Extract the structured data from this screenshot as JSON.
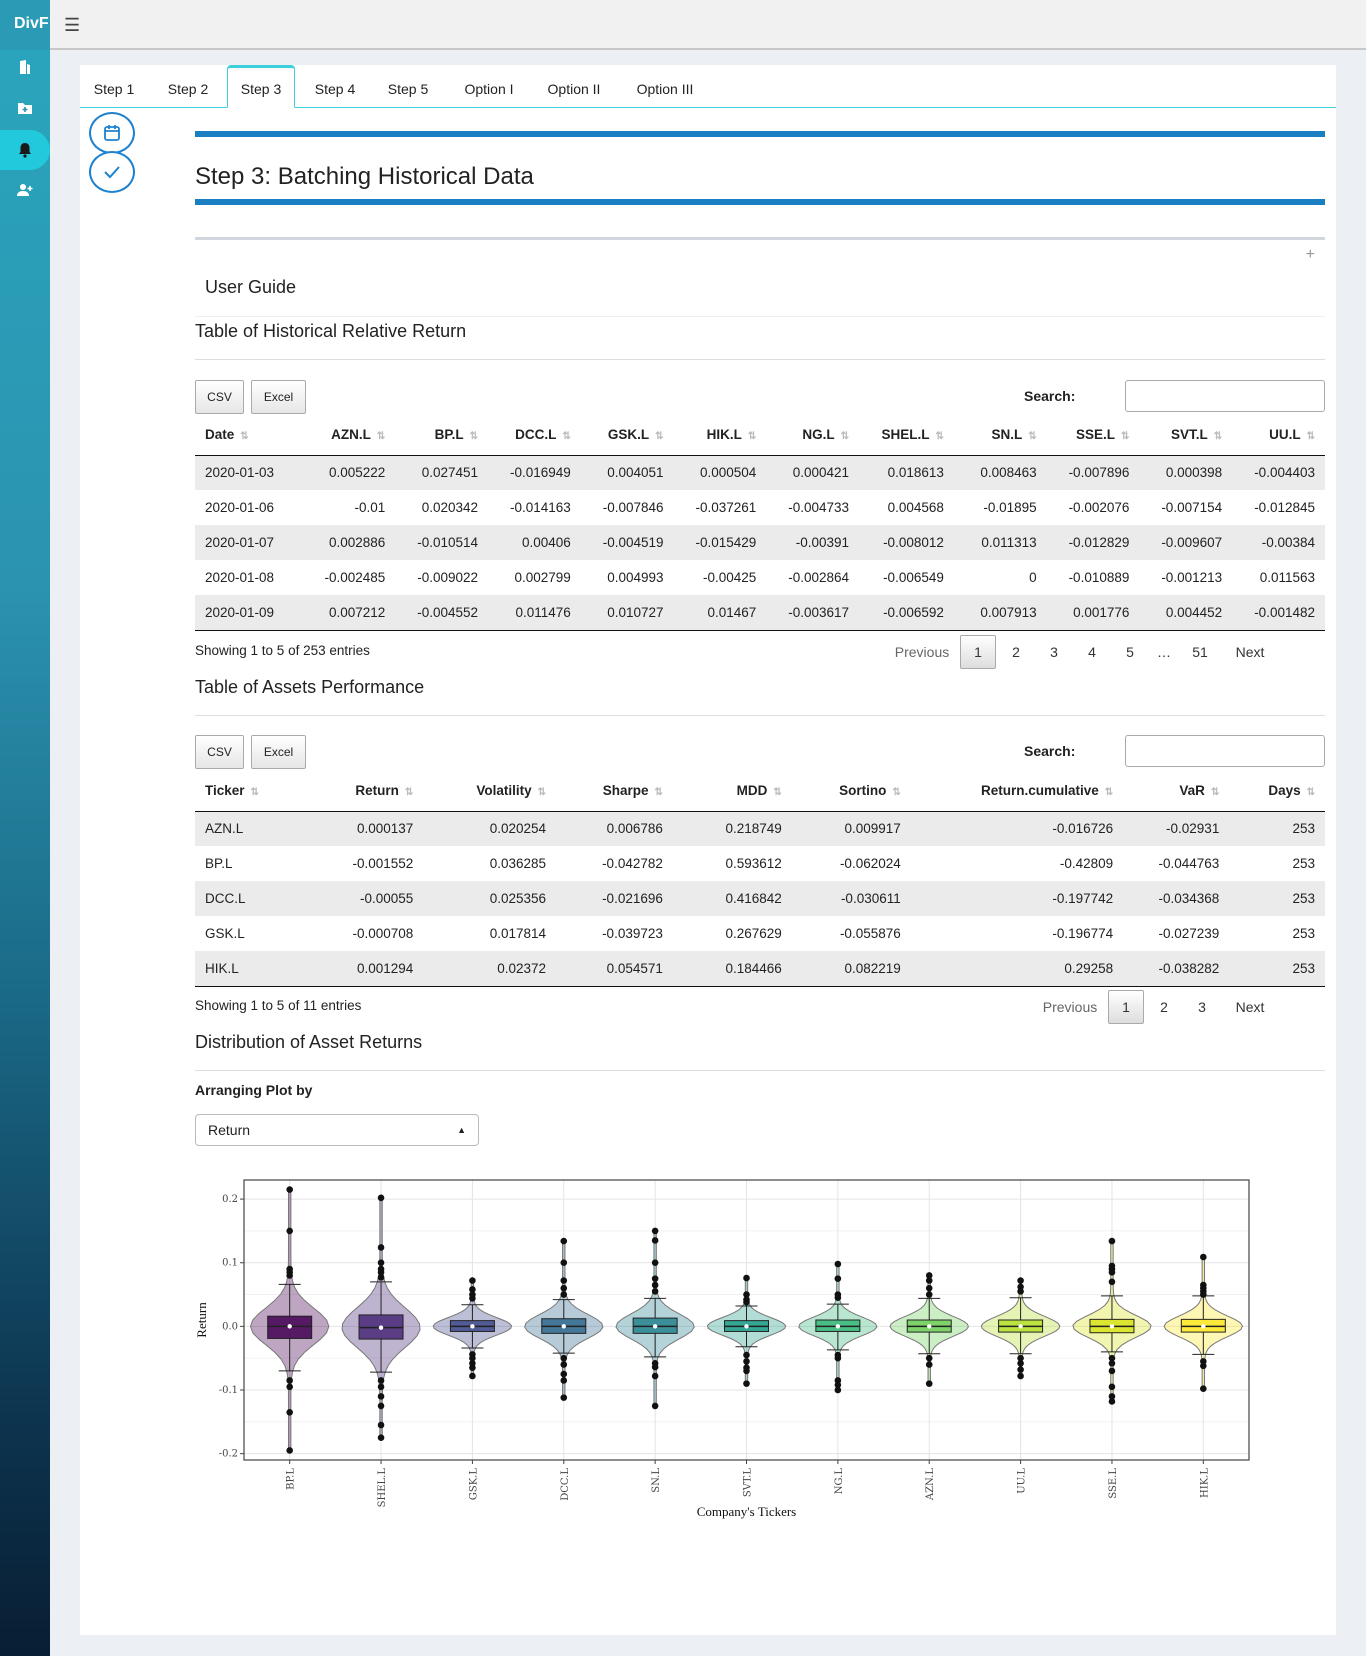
{
  "app": {
    "brand": "DivF",
    "menu_icon": "hamburger-icon"
  },
  "sidebar": {
    "icons": [
      "building-icon",
      "folder-plus-icon",
      "bell-icon",
      "user-plus-icon"
    ],
    "active_index": 2
  },
  "tabs": [
    "Step 1",
    "Step 2",
    "Step 3",
    "Step 4",
    "Step 5",
    "Option I",
    "Option II",
    "Option III"
  ],
  "active_tab": "Step 3",
  "side_buttons": [
    "calendar-icon",
    "check-icon"
  ],
  "page": {
    "title": "Step 3: Batching Historical Data"
  },
  "guide": {
    "title": "User Guide",
    "toggle": "+"
  },
  "returns_section": {
    "title": "Table of Historical Relative Return",
    "buttons": {
      "csv": "CSV",
      "excel": "Excel"
    },
    "search_label": "Search:",
    "search_value": "",
    "columns": [
      "Date",
      "AZN.L",
      "BP.L",
      "DCC.L",
      "GSK.L",
      "HIK.L",
      "NG.L",
      "SHEL.L",
      "SN.L",
      "SSE.L",
      "SVT.L",
      "UU.L"
    ],
    "rows": [
      [
        "2020-01-03",
        "0.005222",
        "0.027451",
        "-0.016949",
        "0.004051",
        "0.000504",
        "0.000421",
        "0.018613",
        "0.008463",
        "-0.007896",
        "0.000398",
        "-0.004403"
      ],
      [
        "2020-01-06",
        "-0.01",
        "0.020342",
        "-0.014163",
        "-0.007846",
        "-0.037261",
        "-0.004733",
        "0.004568",
        "-0.01895",
        "-0.002076",
        "-0.007154",
        "-0.012845"
      ],
      [
        "2020-01-07",
        "0.002886",
        "-0.010514",
        "0.00406",
        "-0.004519",
        "-0.015429",
        "-0.00391",
        "-0.008012",
        "0.011313",
        "-0.012829",
        "-0.009607",
        "-0.00384"
      ],
      [
        "2020-01-08",
        "-0.002485",
        "-0.009022",
        "0.002799",
        "0.004993",
        "-0.00425",
        "-0.002864",
        "-0.006549",
        "0",
        "-0.010889",
        "-0.001213",
        "0.011563"
      ],
      [
        "2020-01-09",
        "0.007212",
        "-0.004552",
        "0.011476",
        "0.010727",
        "0.01467",
        "-0.003617",
        "-0.006592",
        "0.007913",
        "0.001776",
        "0.004452",
        "-0.001482"
      ]
    ],
    "info": "Showing 1 to 5 of 253 entries",
    "pager": {
      "previous": "Previous",
      "pages": [
        "1",
        "2",
        "3",
        "4",
        "5",
        "…",
        "51"
      ],
      "current": "1",
      "next": "Next"
    }
  },
  "perf_section": {
    "title": "Table of Assets Performance",
    "buttons": {
      "csv": "CSV",
      "excel": "Excel"
    },
    "search_label": "Search:",
    "search_value": "",
    "columns": [
      "Ticker",
      "Return",
      "Volatility",
      "Sharpe",
      "MDD",
      "Sortino",
      "Return.cumulative",
      "VaR",
      "Days"
    ],
    "rows": [
      [
        "AZN.L",
        "0.000137",
        "0.020254",
        "0.006786",
        "0.218749",
        "0.009917",
        "-0.016726",
        "-0.02931",
        "253"
      ],
      [
        "BP.L",
        "-0.001552",
        "0.036285",
        "-0.042782",
        "0.593612",
        "-0.062024",
        "-0.42809",
        "-0.044763",
        "253"
      ],
      [
        "DCC.L",
        "-0.00055",
        "0.025356",
        "-0.021696",
        "0.416842",
        "-0.030611",
        "-0.197742",
        "-0.034368",
        "253"
      ],
      [
        "GSK.L",
        "-0.000708",
        "0.017814",
        "-0.039723",
        "0.267629",
        "-0.055876",
        "-0.196774",
        "-0.027239",
        "253"
      ],
      [
        "HIK.L",
        "0.001294",
        "0.02372",
        "0.054571",
        "0.184466",
        "0.082219",
        "0.29258",
        "-0.038282",
        "253"
      ]
    ],
    "info": "Showing 1 to 5 of 11 entries",
    "pager": {
      "previous": "Previous",
      "pages": [
        "1",
        "2",
        "3"
      ],
      "current": "1",
      "next": "Next"
    }
  },
  "dist_section": {
    "title": "Distribution of Asset Returns",
    "control_label": "Arranging Plot by",
    "selected": "Return"
  },
  "chart_data": {
    "type": "violin-box",
    "xlabel": "Company's Tickers",
    "ylabel": "Return",
    "ylim": [
      -0.21,
      0.23
    ],
    "yticks": [
      0.2,
      0.1,
      0.0,
      -0.1,
      -0.2
    ],
    "ytick_labels": [
      "0.2",
      "0.1",
      "0.0",
      "-0.1",
      "-0.2"
    ],
    "grid": true,
    "series": [
      {
        "ticker": "BP.L",
        "color": "#440154",
        "median": 0.0,
        "q1": -0.019,
        "q3": 0.016,
        "whisker_low": -0.07,
        "whisker_high": 0.066,
        "outliers": [
          0.215,
          0.15,
          0.09,
          0.085,
          0.08,
          -0.085,
          -0.095,
          -0.135,
          -0.195
        ]
      },
      {
        "ticker": "SHEL.L",
        "color": "#482878",
        "median": -0.002,
        "q1": -0.02,
        "q3": 0.018,
        "whisker_low": -0.072,
        "whisker_high": 0.07,
        "outliers": [
          0.202,
          0.124,
          0.1,
          0.09,
          0.085,
          0.077,
          -0.085,
          -0.095,
          -0.11,
          -0.125,
          -0.155,
          -0.175
        ]
      },
      {
        "ticker": "GSK.L",
        "color": "#3e4989",
        "median": 0.0,
        "q1": -0.008,
        "q3": 0.009,
        "whisker_low": -0.034,
        "whisker_high": 0.034,
        "outliers": [
          0.072,
          0.058,
          0.05,
          0.044,
          -0.044,
          -0.05,
          -0.058,
          -0.065,
          -0.078
        ]
      },
      {
        "ticker": "DCC.L",
        "color": "#31688e",
        "median": 0.0,
        "q1": -0.011,
        "q3": 0.012,
        "whisker_low": -0.042,
        "whisker_high": 0.042,
        "outliers": [
          0.134,
          0.1,
          0.072,
          0.06,
          0.05,
          -0.05,
          -0.06,
          -0.075,
          -0.085,
          -0.112
        ]
      },
      {
        "ticker": "SN.L",
        "color": "#26828e",
        "median": 0.0,
        "q1": -0.011,
        "q3": 0.013,
        "whisker_low": -0.048,
        "whisker_high": 0.044,
        "outliers": [
          0.15,
          0.135,
          0.1,
          0.075,
          0.065,
          0.055,
          -0.058,
          -0.064,
          -0.078,
          -0.125
        ]
      },
      {
        "ticker": "SVT.L",
        "color": "#1f9e89",
        "median": 0.0,
        "q1": -0.008,
        "q3": 0.009,
        "whisker_low": -0.032,
        "whisker_high": 0.032,
        "outliers": [
          0.076,
          0.05,
          0.042,
          0.038,
          -0.045,
          -0.055,
          -0.065,
          -0.07,
          -0.09
        ]
      },
      {
        "ticker": "NG.L",
        "color": "#35b779",
        "median": 0.0,
        "q1": -0.008,
        "q3": 0.01,
        "whisker_low": -0.037,
        "whisker_high": 0.035,
        "outliers": [
          0.098,
          0.075,
          0.05,
          0.045,
          -0.045,
          -0.05,
          -0.085,
          -0.092,
          -0.1
        ]
      },
      {
        "ticker": "AZN.L",
        "color": "#6ece58",
        "median": 0.0,
        "q1": -0.009,
        "q3": 0.01,
        "whisker_low": -0.043,
        "whisker_high": 0.044,
        "outliers": [
          0.08,
          0.072,
          0.06,
          0.05,
          -0.05,
          -0.06,
          -0.09
        ]
      },
      {
        "ticker": "UU.L",
        "color": "#b5de2b",
        "median": 0.0,
        "q1": -0.009,
        "q3": 0.01,
        "whisker_low": -0.043,
        "whisker_high": 0.045,
        "outliers": [
          0.072,
          0.062,
          0.055,
          -0.05,
          -0.058,
          -0.068,
          -0.078
        ]
      },
      {
        "ticker": "SSE.L",
        "color": "#d8e219",
        "median": 0.0,
        "q1": -0.01,
        "q3": 0.011,
        "whisker_low": -0.04,
        "whisker_high": 0.048,
        "outliers": [
          0.134,
          0.095,
          0.09,
          0.085,
          0.07,
          -0.05,
          -0.058,
          -0.07,
          -0.095,
          -0.11,
          -0.118
        ]
      },
      {
        "ticker": "HIK.L",
        "color": "#fde725",
        "median": 0.0,
        "q1": -0.009,
        "q3": 0.011,
        "whisker_low": -0.044,
        "whisker_high": 0.048,
        "outliers": [
          0.109,
          0.065,
          0.06,
          0.055,
          0.05,
          -0.055,
          -0.062,
          -0.098
        ]
      }
    ]
  }
}
